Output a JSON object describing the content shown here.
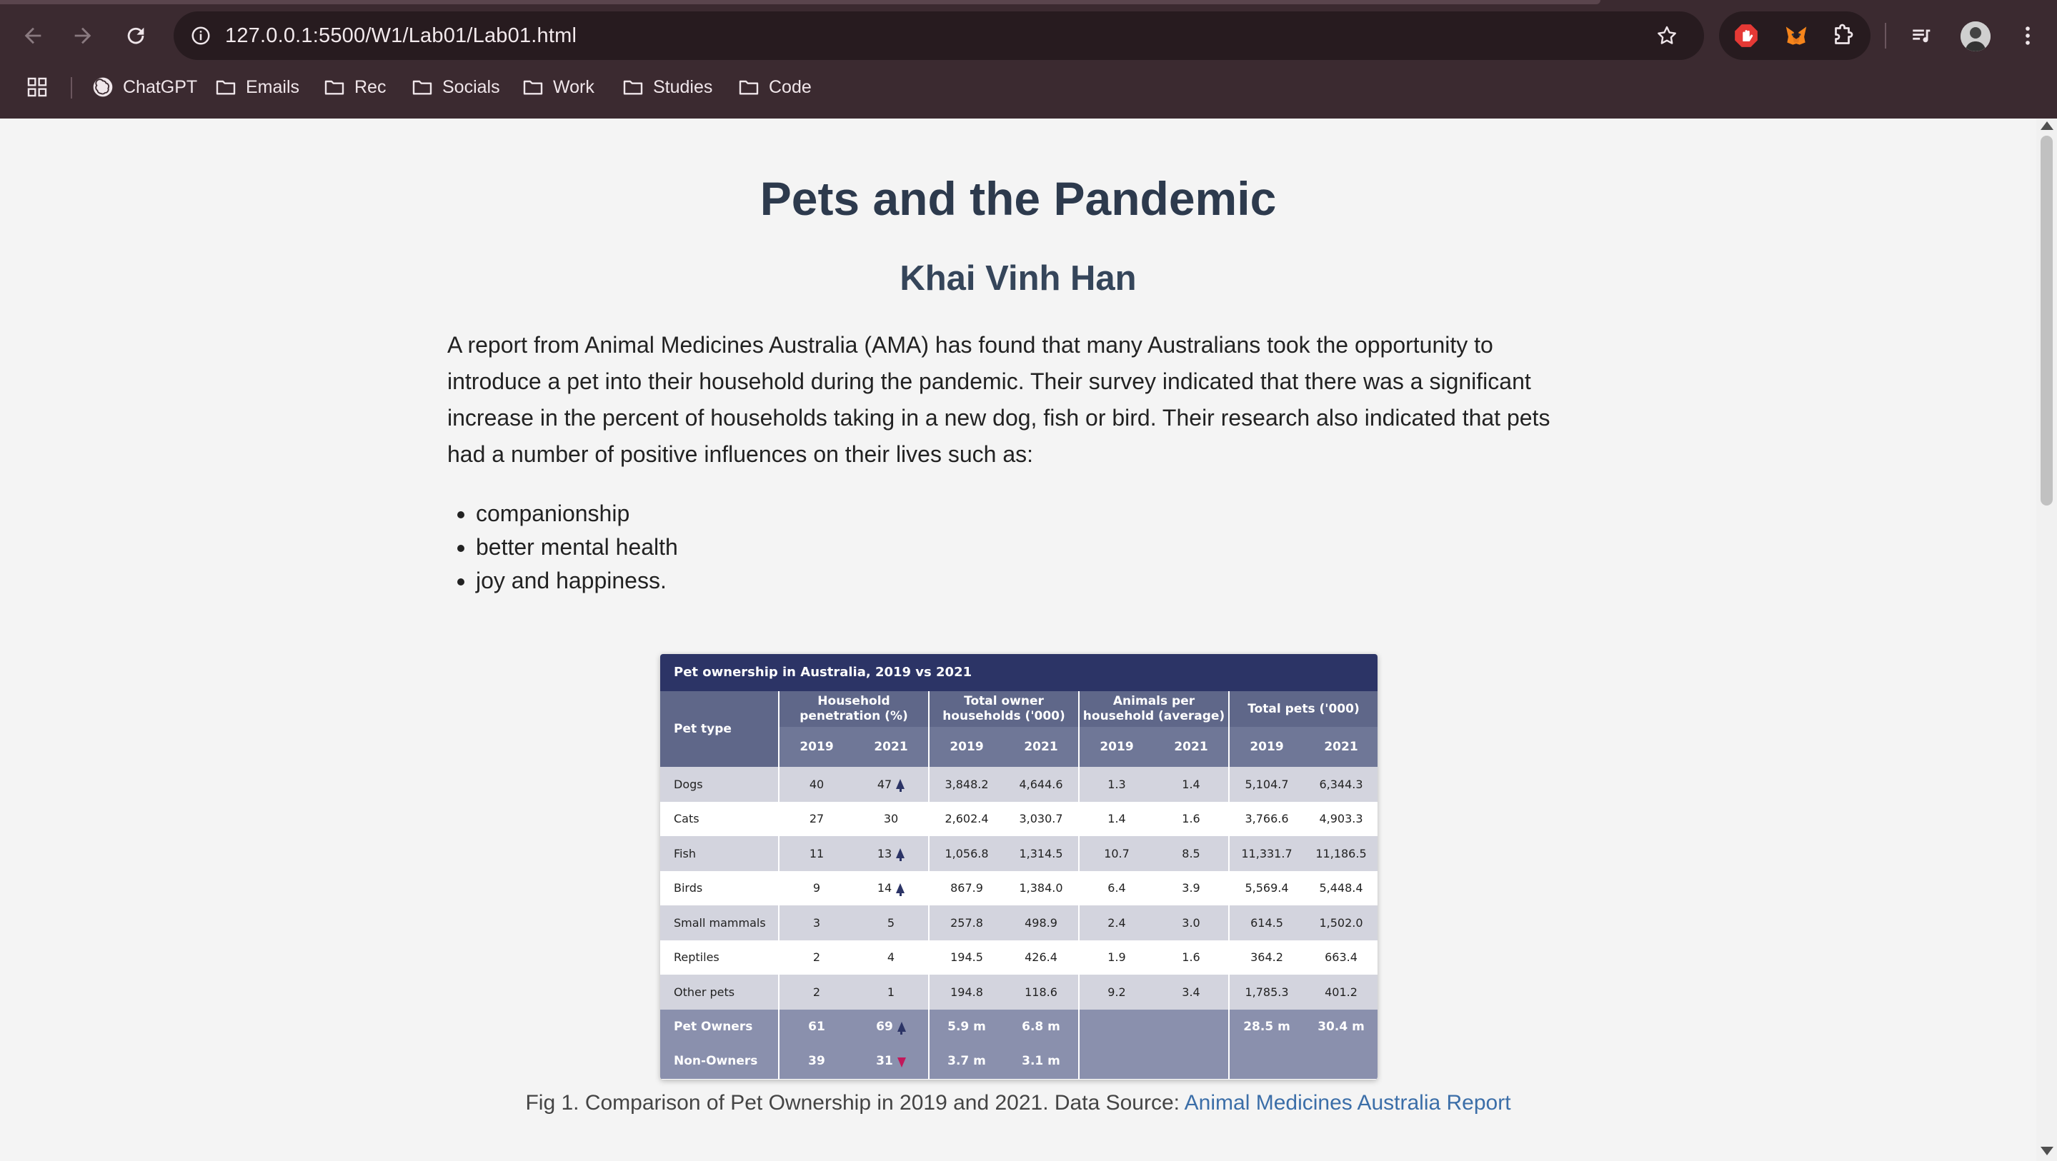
{
  "browser": {
    "url": "127.0.0.1:5500/W1/Lab01/Lab01.html",
    "bookmarks": [
      {
        "label": "ChatGPT",
        "icon": "chatgpt-icon"
      },
      {
        "label": "Emails",
        "icon": "folder-icon"
      },
      {
        "label": "Rec",
        "icon": "folder-icon"
      },
      {
        "label": "Socials",
        "icon": "folder-icon"
      },
      {
        "label": "Work",
        "icon": "folder-icon"
      },
      {
        "label": "Studies",
        "icon": "folder-icon"
      },
      {
        "label": "Code",
        "icon": "folder-icon"
      }
    ],
    "colors": {
      "frame": "#3b2a30",
      "omnibox": "#271b1f"
    }
  },
  "page": {
    "title": "Pets and the Pandemic",
    "author": "Khai Vinh Han",
    "intro": "A report from Animal Medicines Australia (AMA) has found that many Australians took the opportunity to introduce a pet into their household during the pandemic. Their survey indicated that there was a significant increase in the percent of households taking in a new dog, fish or bird. Their research also indicated that pets had a number of positive influences on their lives such as:",
    "benefits": [
      "companionship",
      "better mental health",
      "joy and happiness."
    ],
    "caption_text": "Fig 1. Comparison of Pet Ownership in 2019 and 2021. Data Source: ",
    "caption_link": "Animal Medicines Australia Report"
  },
  "figure": {
    "title": "Pet ownership in Australia, 2019 vs 2021",
    "pet_type_header": "Pet type",
    "groups": [
      "Household penetration (%)",
      "Total owner households ('000)",
      "Animals per household (average)",
      "Total pets ('000)"
    ],
    "years": [
      "2019",
      "2021",
      "2019",
      "2021",
      "2019",
      "2021",
      "2019",
      "2021"
    ],
    "rows": [
      {
        "name": "Dogs",
        "values": [
          "40",
          "47",
          "3,848.2",
          "4,644.6",
          "1.3",
          "1.4",
          "5,104.7",
          "6,344.3"
        ],
        "trend": "up"
      },
      {
        "name": "Cats",
        "values": [
          "27",
          "30",
          "2,602.4",
          "3,030.7",
          "1.4",
          "1.6",
          "3,766.6",
          "4,903.3"
        ],
        "trend": ""
      },
      {
        "name": "Fish",
        "values": [
          "11",
          "13",
          "1,056.8",
          "1,314.5",
          "10.7",
          "8.5",
          "11,331.7",
          "11,186.5"
        ],
        "trend": "up"
      },
      {
        "name": "Birds",
        "values": [
          "9",
          "14",
          "867.9",
          "1,384.0",
          "6.4",
          "3.9",
          "5,569.4",
          "5,448.4"
        ],
        "trend": "up"
      },
      {
        "name": "Small mammals",
        "values": [
          "3",
          "5",
          "257.8",
          "498.9",
          "2.4",
          "3.0",
          "614.5",
          "1,502.0"
        ],
        "trend": ""
      },
      {
        "name": "Reptiles",
        "values": [
          "2",
          "4",
          "194.5",
          "426.4",
          "1.9",
          "1.6",
          "364.2",
          "663.4"
        ],
        "trend": ""
      },
      {
        "name": "Other pets",
        "values": [
          "2",
          "1",
          "194.8",
          "118.6",
          "9.2",
          "3.4",
          "1,785.3",
          "401.2"
        ],
        "trend": ""
      }
    ],
    "totals": [
      {
        "name": "Pet Owners",
        "values": [
          "61",
          "69",
          "5.9 m",
          "6.8 m",
          "",
          "",
          "28.5 m",
          "30.4 m"
        ],
        "trend": "up"
      },
      {
        "name": "Non-Owners",
        "values": [
          "39",
          "31",
          "3.7 m",
          "3.1 m",
          "",
          "",
          "",
          ""
        ],
        "trend": "down"
      }
    ],
    "colors": {
      "title_bg": "#2c3466",
      "header_bg": "#5f6789",
      "odd_row": "#d3d4de",
      "total_row": "#8a90ad",
      "arrow_up": "#2c3466",
      "arrow_down": "#c2185b"
    }
  }
}
